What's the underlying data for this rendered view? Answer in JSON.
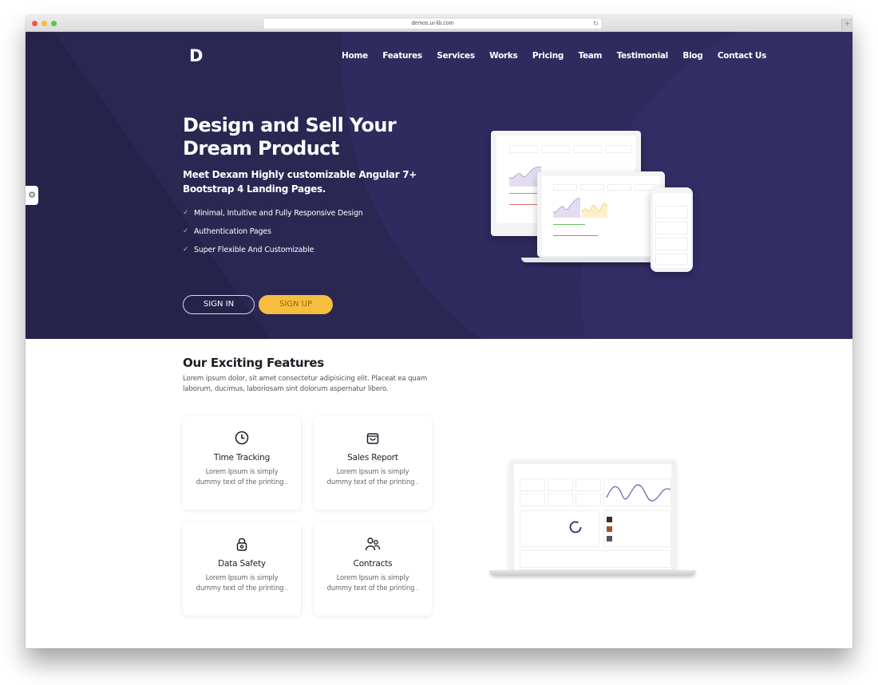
{
  "browser": {
    "url": "demos.ui-lib.com",
    "reload_icon": "↻",
    "new_tab_icon": "+"
  },
  "header": {
    "logo": "D",
    "nav": [
      "Home",
      "Features",
      "Services",
      "Works",
      "Pricing",
      "Team",
      "Testimonial",
      "Blog",
      "Contact Us"
    ]
  },
  "hero": {
    "title": "Design and Sell Your Dream Product",
    "subtitle": "Meet Dexam Highly customizable Angular 7+ Bootstrap 4 Landing Pages.",
    "checklist": [
      "Minimal, Intuitive and Fully Responsive Design",
      "Authentication Pages",
      "Super Flexible And Customizable"
    ],
    "check_icon": "✓",
    "sign_in": "SIGN IN",
    "sign_up": "SIGN UP",
    "settings_icon": "⚙"
  },
  "features": {
    "title": "Our Exciting Features",
    "description": "Lorem ipsum dolor, sit amet consectetur adipisicing elit. Placeat ea quam laborum, ducimus, laboriosam sint dolorum aspernatur libero.",
    "cards": [
      {
        "icon": "clock-icon",
        "title": "Time Tracking",
        "text": "Lorem Ipsum is simply dummy text of the printing ."
      },
      {
        "icon": "shopping-bag-icon",
        "title": "Sales Report",
        "text": "Lorem Ipsum is simply dummy text of the printing ."
      },
      {
        "icon": "lock-icon",
        "title": "Data Safety",
        "text": "Lorem Ipsum is simply dummy text of the printing ."
      },
      {
        "icon": "users-icon",
        "title": "Contracts",
        "text": "Lorem Ipsum is simply dummy text of the printing ."
      }
    ]
  },
  "colors": {
    "hero_bg": "#2a2753",
    "accent_yellow": "#f6be3e",
    "check_color": "#d9b35a"
  }
}
